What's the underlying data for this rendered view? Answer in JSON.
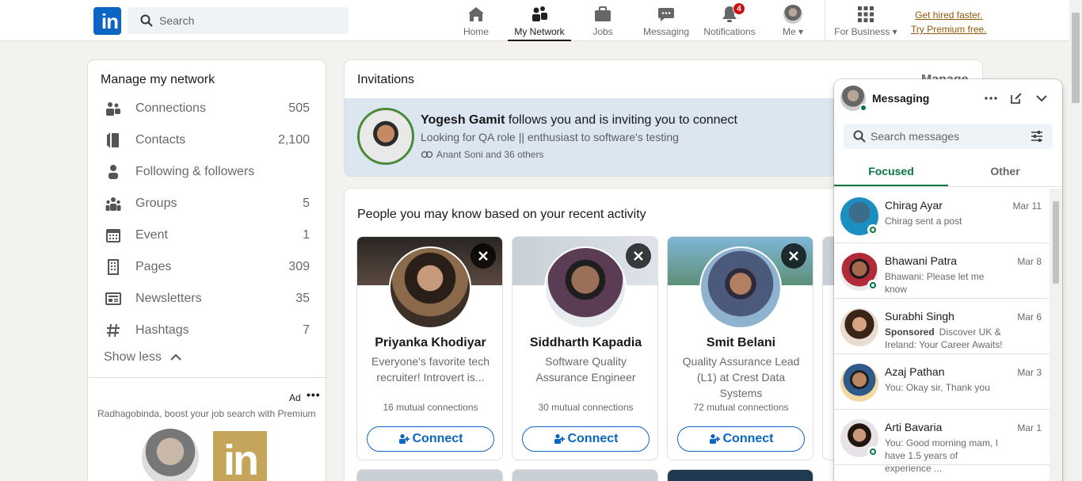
{
  "nav": {
    "search_placeholder": "Search",
    "items": [
      {
        "label": "Home",
        "icon": "home-icon"
      },
      {
        "label": "My Network",
        "icon": "network-icon"
      },
      {
        "label": "Jobs",
        "icon": "briefcase-icon"
      },
      {
        "label": "Messaging",
        "icon": "chat-icon"
      },
      {
        "label": "Notifications",
        "icon": "bell-icon",
        "badge": "4"
      },
      {
        "label": "Me",
        "icon": "avatar"
      },
      {
        "label": "For Business",
        "icon": "grid-icon"
      }
    ],
    "premium_line1": "Get hired faster.",
    "premium_line2": "Try Premium free."
  },
  "manage": {
    "title": "Manage my network",
    "items": [
      {
        "label": "Connections",
        "count": "505",
        "icon": "people-icon"
      },
      {
        "label": "Contacts",
        "count": "2,100",
        "icon": "contacts-icon"
      },
      {
        "label": "Following & followers",
        "count": "",
        "icon": "person-icon"
      },
      {
        "label": "Groups",
        "count": "5",
        "icon": "group-icon"
      },
      {
        "label": "Event",
        "count": "1",
        "icon": "calendar-icon"
      },
      {
        "label": "Pages",
        "count": "309",
        "icon": "building-icon"
      },
      {
        "label": "Newsletters",
        "count": "35",
        "icon": "newsletter-icon"
      },
      {
        "label": "Hashtags",
        "count": "7",
        "icon": "hashtag-icon"
      }
    ],
    "show_less": "Show less",
    "ad_label": "Ad",
    "ad_text": "Radhagobinda, boost your job search with Premium"
  },
  "invitations": {
    "title": "Invitations",
    "manage": "Manage",
    "name": "Yogesh Gamit",
    "action": " follows you and is inviting you to connect",
    "headline": "Looking for QA role || enthusiast to software's testing",
    "mutual": "Anant Soni and 36 others"
  },
  "pymk": {
    "title": "People you may know based on your recent activity",
    "connect_label": "Connect",
    "people": [
      {
        "name": "Priyanka Khodiyar",
        "headline": "Everyone's favorite tech recruiter! Introvert is...",
        "mutual": "16 mutual connections"
      },
      {
        "name": "Siddharth Kapadia",
        "headline": "Software Quality Assurance Engineer",
        "mutual": "30 mutual connections"
      },
      {
        "name": "Smit Belani",
        "headline": "Quality Assurance Lead (L1) at Crest Data Systems",
        "mutual": "72 mutual connections"
      }
    ]
  },
  "messaging": {
    "title": "Messaging",
    "search_placeholder": "Search messages",
    "tabs": [
      "Focused",
      "Other"
    ],
    "conversations": [
      {
        "name": "Chirag Ayar",
        "date": "Mar 11",
        "preview": "Chirag sent a post",
        "sponsored": ""
      },
      {
        "name": "Bhawani Patra",
        "date": "Mar 8",
        "preview": "Bhawani: Please let me know",
        "sponsored": ""
      },
      {
        "name": "Surabhi Singh",
        "date": "Mar 6",
        "preview": "Discover UK & Ireland: Your Career Awaits!",
        "sponsored": "Sponsored"
      },
      {
        "name": "Azaj Pathan",
        "date": "Mar 3",
        "preview": "You: Okay sir, Thank you",
        "sponsored": ""
      },
      {
        "name": "Arti Bavaria",
        "date": "Mar 1",
        "preview": "You: Good morning mam, I have 1.5 years of experience ...",
        "sponsored": ""
      }
    ]
  },
  "colors": {
    "brand": "#0a66c2",
    "online": "#057642",
    "badge": "#cc1016",
    "premium": "#915907"
  }
}
